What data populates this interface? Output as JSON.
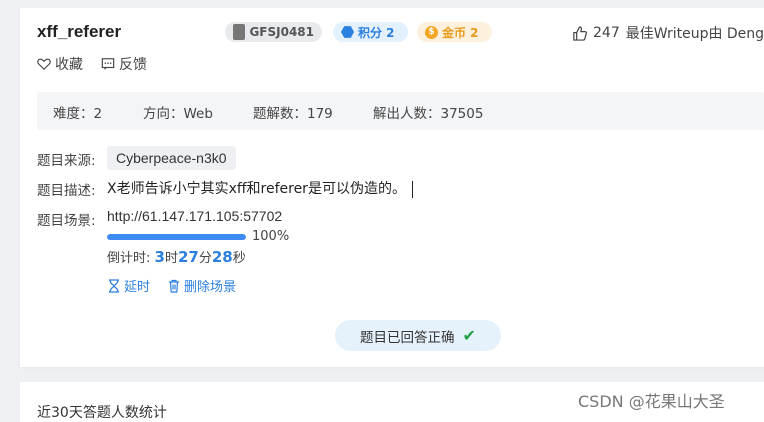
{
  "challenge": {
    "title": "xff_referer",
    "id_badge": "GFSJ0481",
    "score_badge": "积分 2",
    "coin_badge": "金币 2",
    "likes": "247",
    "best_writeup": "最佳Writeup由 DengZ"
  },
  "actions": {
    "favorite": "收藏",
    "feedback": "反馈"
  },
  "stats": {
    "difficulty": "难度：2",
    "direction": "方向：Web",
    "solves": "题解数：179",
    "solvers": "解出人数：37505"
  },
  "details": {
    "source_label": "题目来源:",
    "source_value": "Cyberpeace-n3k0",
    "desc_label": "题目描述:",
    "desc_value": "X老师告诉小宁其实xff和referer是可以伪造的。",
    "scene_label": "题目场景:",
    "scene_url": "http://61.147.171.105:57702",
    "progress_percent": 100,
    "progress_text": "100%",
    "countdown_label": "倒计时:",
    "hours": "3",
    "hours_unit": "时",
    "minutes": "27",
    "minutes_unit": "分",
    "seconds": "28",
    "seconds_unit": "秒",
    "extend_label": "延时",
    "delete_label": "删除场景"
  },
  "status": {
    "answered_label": "题目已回答正确"
  },
  "stats_section": {
    "title": "近30天答题人数统计"
  },
  "watermark": "CSDN @花果山大圣",
  "colors": {
    "accent": "#2b7fe0",
    "success": "#24a148",
    "coin": "#f5a623"
  }
}
